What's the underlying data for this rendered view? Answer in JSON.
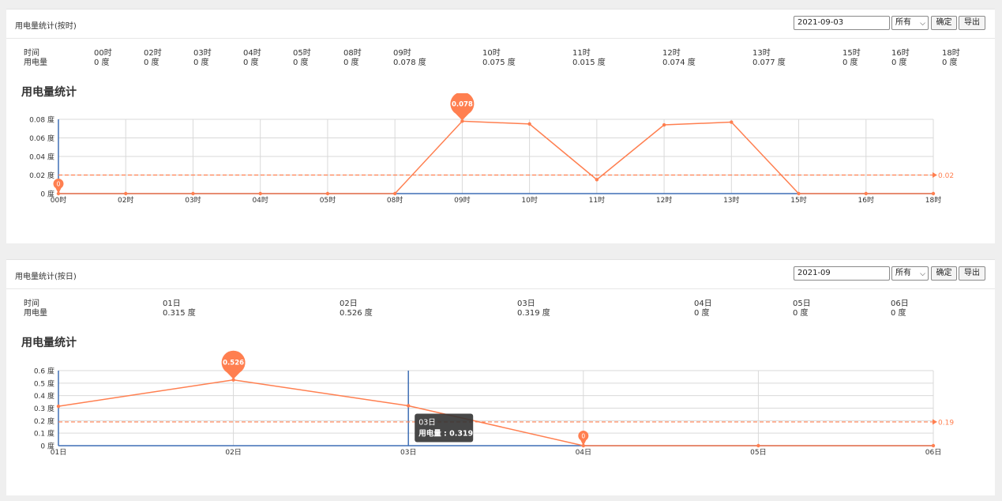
{
  "panels": [
    {
      "title": "用电量统计(按时)",
      "date_value": "2021-09-03",
      "select_value": "所有",
      "ok_label": "确定",
      "export_label": "导出",
      "row_labels": [
        "时间",
        "用电量"
      ],
      "columns": [
        {
          "time": "00时",
          "value": "0 度"
        },
        {
          "time": "02时",
          "value": "0 度"
        },
        {
          "time": "03时",
          "value": "0 度"
        },
        {
          "time": "04时",
          "value": "0 度"
        },
        {
          "time": "05时",
          "value": "0 度"
        },
        {
          "time": "08时",
          "value": "0 度"
        },
        {
          "time": "09时",
          "value": "0.078 度"
        },
        {
          "time": "10时",
          "value": "0.075 度"
        },
        {
          "time": "11时",
          "value": "0.015 度"
        },
        {
          "time": "12时",
          "value": "0.074 度"
        },
        {
          "time": "13时",
          "value": "0.077 度"
        },
        {
          "time": "15时",
          "value": "0 度"
        },
        {
          "time": "16时",
          "value": "0 度"
        },
        {
          "time": "18时",
          "value": "0 度"
        }
      ],
      "chart_title": "用电量统计"
    },
    {
      "title": "用电量统计(按日)",
      "date_value": "2021-09",
      "select_value": "所有",
      "ok_label": "确定",
      "export_label": "导出",
      "row_labels": [
        "时间",
        "用电量"
      ],
      "columns": [
        {
          "time": "01日",
          "value": "0.315 度"
        },
        {
          "time": "02日",
          "value": "0.526 度"
        },
        {
          "time": "03日",
          "value": "0.319 度"
        },
        {
          "time": "04日",
          "value": "0 度"
        },
        {
          "time": "05日",
          "value": "0 度"
        },
        {
          "time": "06日",
          "value": "0 度"
        }
      ],
      "chart_title": "用电量统计"
    }
  ],
  "chart_data": [
    {
      "type": "line",
      "title": "用电量统计",
      "categories": [
        "00时",
        "02时",
        "03时",
        "04时",
        "05时",
        "08时",
        "09时",
        "10时",
        "11时",
        "12时",
        "13时",
        "15时",
        "16时",
        "18时"
      ],
      "series": [
        {
          "values": [
            0,
            0,
            0,
            0,
            0,
            0,
            0.078,
            0.075,
            0.015,
            0.074,
            0.077,
            0,
            0,
            0
          ]
        }
      ],
      "y_ticks": [
        0,
        0.02,
        0.04,
        0.06,
        0.08
      ],
      "y_tick_labels": [
        "0 度",
        "0.02 度",
        "0.04 度",
        "0.06 度",
        "0.08 度"
      ],
      "ylim": [
        0,
        0.08
      ],
      "average_line": {
        "value": 0.02,
        "label": "0.02"
      },
      "markers": [
        {
          "category": "09时",
          "value": 0.078,
          "label": "0.078"
        },
        {
          "category": "00时",
          "value": 0,
          "label": "0"
        }
      ],
      "grid": true,
      "colors": {
        "line": "#ff7f50",
        "axis": "#3f6fb5",
        "grid": "#d9d9d9"
      }
    },
    {
      "type": "line",
      "title": "用电量统计",
      "categories": [
        "01日",
        "02日",
        "03日",
        "04日",
        "05日",
        "06日"
      ],
      "series": [
        {
          "values": [
            0.315,
            0.526,
            0.319,
            0,
            0,
            0
          ]
        }
      ],
      "y_ticks": [
        0,
        0.1,
        0.2,
        0.3,
        0.4,
        0.5,
        0.6
      ],
      "y_tick_labels": [
        "0 度",
        "0.1 度",
        "0.2 度",
        "0.3 度",
        "0.4 度",
        "0.5 度",
        "0.6 度"
      ],
      "ylim": [
        0,
        0.6
      ],
      "average_line": {
        "value": 0.19,
        "label": "0.19"
      },
      "markers": [
        {
          "category": "02日",
          "value": 0.526,
          "label": "0.526"
        },
        {
          "category": "04日",
          "value": 0,
          "label": "0"
        }
      ],
      "tooltip": {
        "category": "03日",
        "title": "03日",
        "text": "用电量 : 0.319"
      },
      "grid": true,
      "colors": {
        "line": "#ff7f50",
        "axis": "#3f6fb5",
        "grid": "#d9d9d9"
      }
    }
  ]
}
